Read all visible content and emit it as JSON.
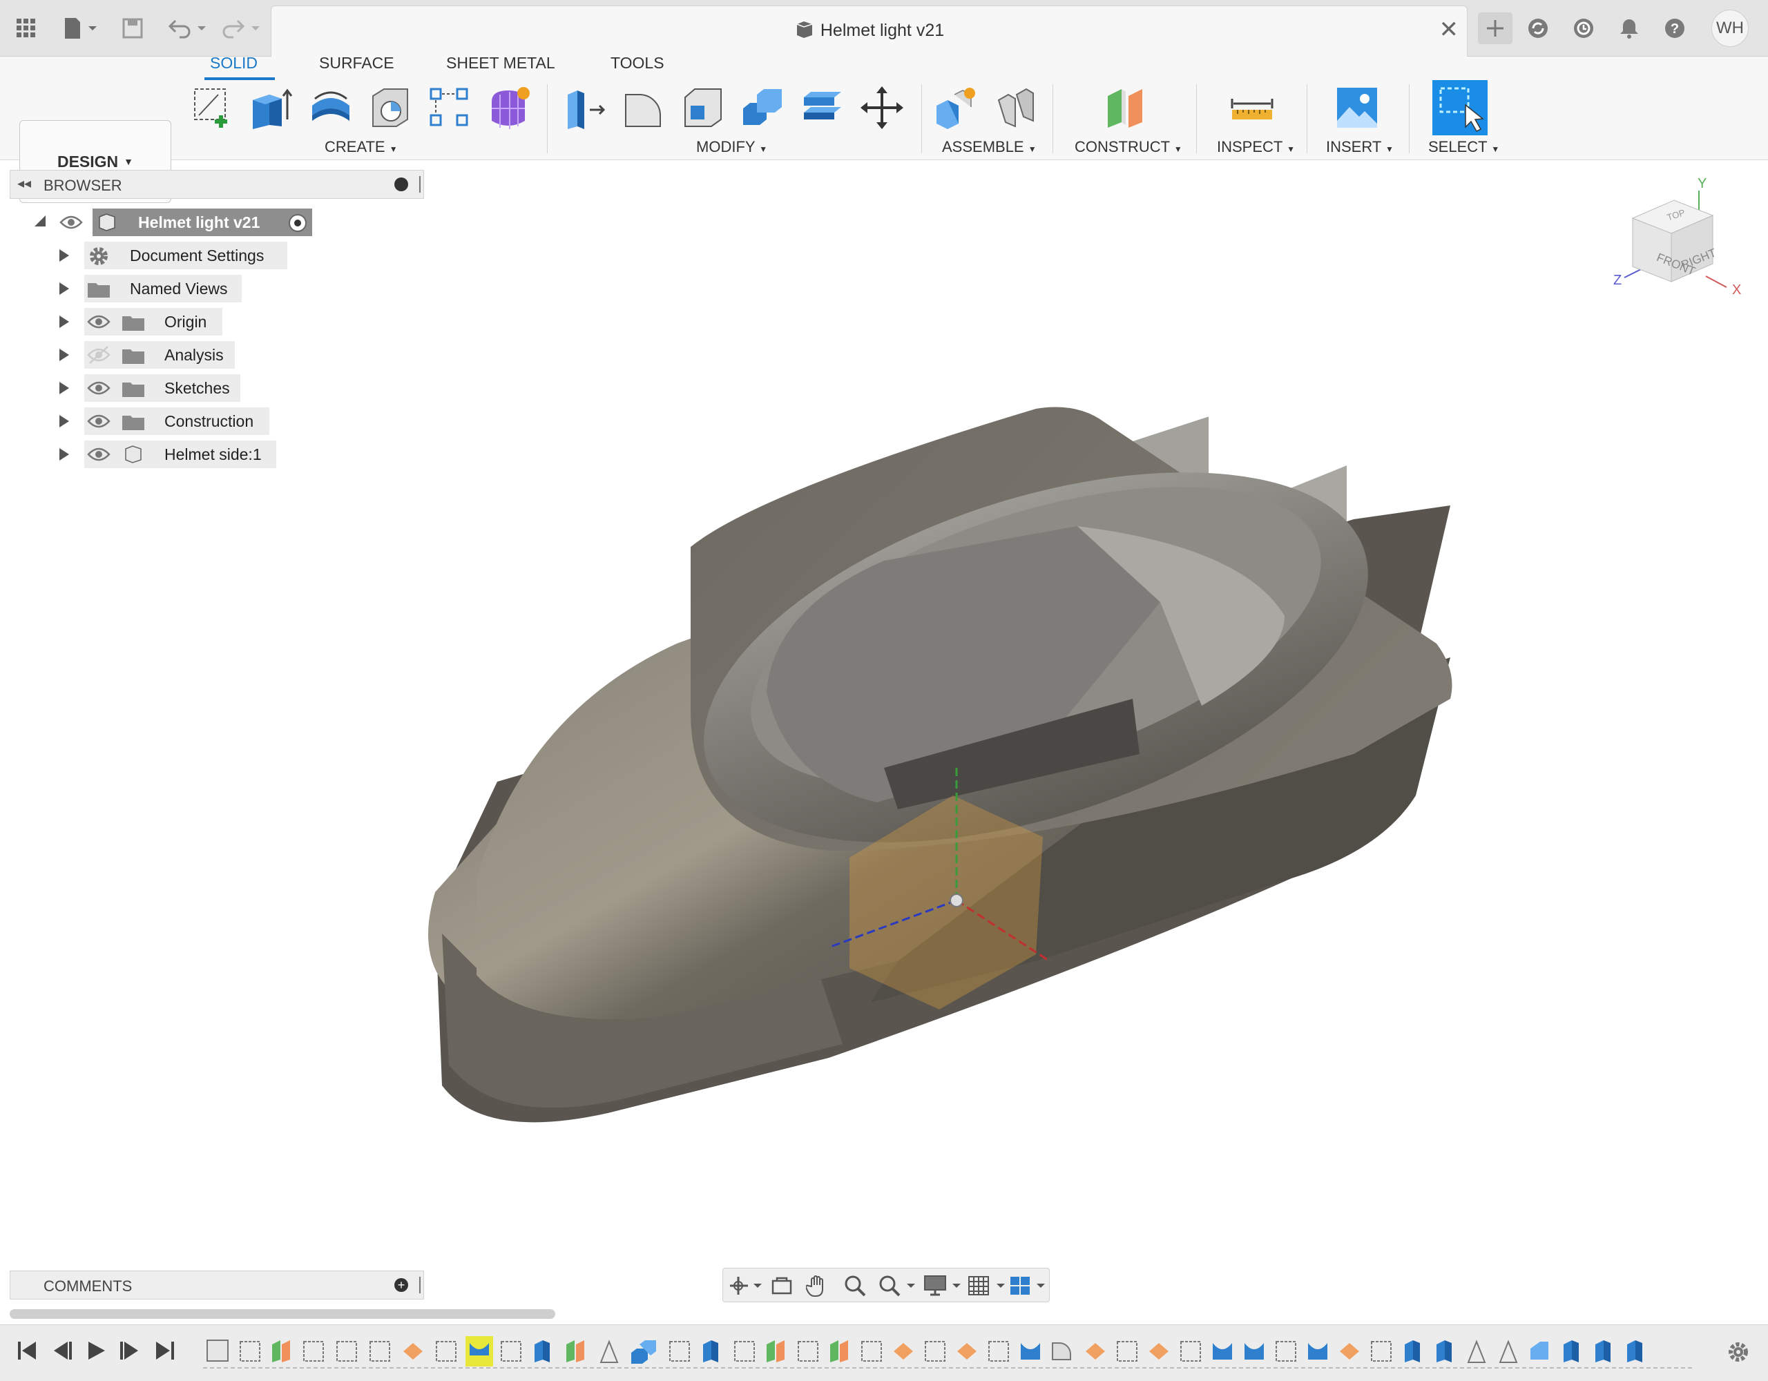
{
  "window": {
    "title": "Helmet light v21",
    "user_initials": "WH"
  },
  "ribbon": {
    "workspace": "DESIGN",
    "tabs": [
      {
        "label": "SOLID",
        "active": true
      },
      {
        "label": "SURFACE",
        "active": false
      },
      {
        "label": "SHEET METAL",
        "active": false
      },
      {
        "label": "TOOLS",
        "active": false
      }
    ],
    "groups": {
      "create": "CREATE",
      "modify": "MODIFY",
      "assemble": "ASSEMBLE",
      "construct": "CONSTRUCT",
      "inspect": "INSPECT",
      "insert": "INSERT",
      "select": "SELECT"
    }
  },
  "browser": {
    "header": "BROWSER",
    "root": "Helmet light v21",
    "items": [
      {
        "label": "Document Settings",
        "icon": "gear-icon"
      },
      {
        "label": "Named Views",
        "icon": "folder-icon"
      },
      {
        "label": "Origin",
        "icon": "folder-icon"
      },
      {
        "label": "Analysis",
        "icon": "folder-icon"
      },
      {
        "label": "Sketches",
        "icon": "folder-icon"
      },
      {
        "label": "Construction",
        "icon": "folder-icon"
      },
      {
        "label": "Helmet side:1",
        "icon": "component-icon"
      }
    ]
  },
  "comments": {
    "header": "COMMENTS"
  },
  "viewcube": {
    "front": "FRONT",
    "right": "RIGHT",
    "top": "TOP",
    "axis_x": "X",
    "axis_y": "Y",
    "axis_z": "Z"
  },
  "colors": {
    "accent": "#1a79c8",
    "body": "#6f6a60",
    "highlight": "#e8e83a"
  }
}
